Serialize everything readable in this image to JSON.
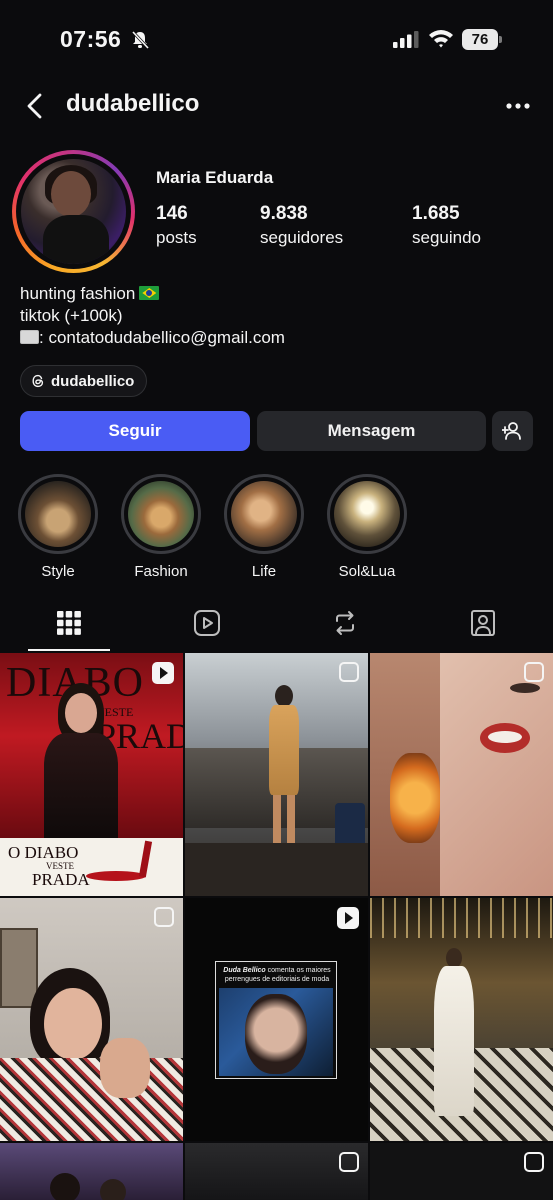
{
  "status_bar": {
    "time": "07:56",
    "battery": "76"
  },
  "header": {
    "username": "dudabellico"
  },
  "profile": {
    "full_name": "Maria Eduarda",
    "stats": [
      {
        "value": "146",
        "label": "posts"
      },
      {
        "value": "9.838",
        "label": "seguidores"
      },
      {
        "value": "1.685",
        "label": "seguindo"
      }
    ],
    "bio": {
      "line1": "hunting fashion",
      "line2": "tiktok (+100k)",
      "line3": ": contatodudabellico@gmail.com"
    },
    "threads_handle": "dudabellico"
  },
  "actions": {
    "follow_label": "Seguir",
    "message_label": "Mensagem"
  },
  "highlights": [
    {
      "label": "Style"
    },
    {
      "label": "Fashion"
    },
    {
      "label": "Life"
    },
    {
      "label": "Sol&Lua"
    }
  ],
  "tabs": [
    {
      "icon": "grid-icon",
      "active": true
    },
    {
      "icon": "reels-icon",
      "active": false
    },
    {
      "icon": "reposts-icon",
      "active": false
    },
    {
      "icon": "tagged-icon",
      "active": false
    }
  ],
  "posts": [
    {
      "badge": "reel",
      "text_top": "DIABO",
      "text_mid": "VESTE",
      "text_mid2": "PRADA",
      "text_bottom1": "O DIABO",
      "text_bottom2": "VESTE",
      "text_bottom3": "PRADA"
    },
    {
      "badge": "carousel"
    },
    {
      "badge": "carousel"
    },
    {
      "badge": "carousel"
    },
    {
      "badge": "reel",
      "caption_bold": "Duda Bellico",
      "caption_rest": "comenta os maiores perrengues de editoriais de moda"
    },
    {
      "badge": "none"
    },
    {
      "badge": "none"
    },
    {
      "badge": "carousel"
    },
    {
      "badge": "carousel"
    }
  ],
  "colors": {
    "background": "#0b0b0d",
    "follow_button": "#4a5cf4",
    "secondary_button": "#26272b"
  }
}
